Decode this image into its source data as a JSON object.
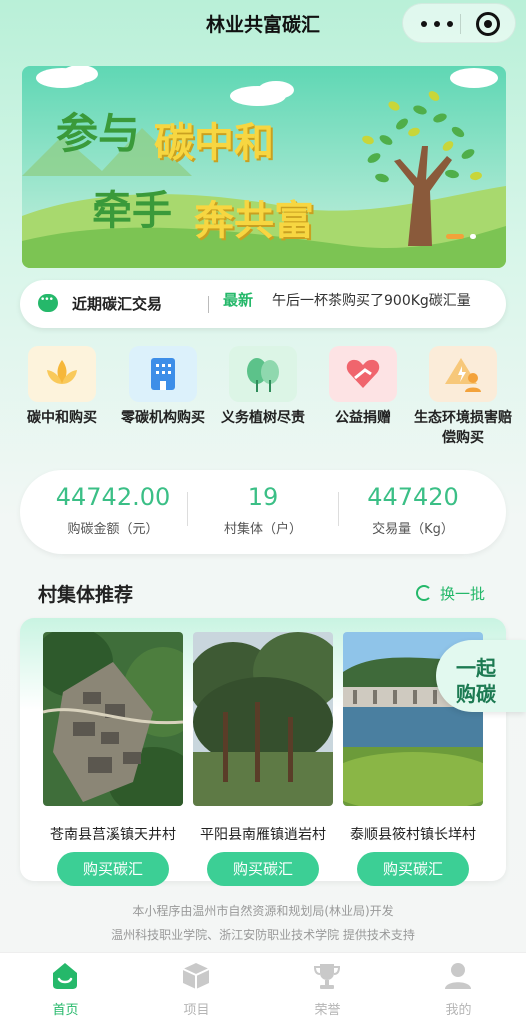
{
  "header": {
    "title": "林业共富碳汇"
  },
  "banner": {
    "line1a": "参与",
    "line1b": "碳中和",
    "line2a": "牵手",
    "line2b": "奔共富"
  },
  "notice": {
    "label": "近期碳汇交易",
    "badge": "最新",
    "text": "午后一杯茶购买了900Kg碳汇量"
  },
  "categories": [
    {
      "label": "碳中和购买",
      "icon": "wheat-icon"
    },
    {
      "label": "零碳机构购买",
      "icon": "building-icon"
    },
    {
      "label": "义务植树尽责",
      "icon": "trees-icon"
    },
    {
      "label": "公益捐赠",
      "icon": "heart-hand-icon"
    },
    {
      "label": "生态环境损害赔偿购买",
      "icon": "warning-person-icon"
    }
  ],
  "stats": [
    {
      "value": "44742.00",
      "label": "购碳金额（元）"
    },
    {
      "value": "19",
      "label": "村集体（户）"
    },
    {
      "value": "447420",
      "label": "交易量（Kg）"
    }
  ],
  "recommend": {
    "title": "村集体推荐",
    "refresh": "换一批",
    "together_line1": "一起",
    "together_line2": "购碳",
    "cards": [
      {
        "name": "苍南县莒溪镇天井村",
        "button": "购买碳汇"
      },
      {
        "name": "平阳县南雁镇逍岩村",
        "button": "购买碳汇"
      },
      {
        "name": "泰顺县筱村镇长垟村",
        "button": "购买碳汇"
      }
    ]
  },
  "footer": {
    "line1": "本小程序由温州市自然资源和规划局(林业局)开发",
    "line2": "温州科技职业学院、浙江安防职业技术学院 提供技术支持"
  },
  "tabs": [
    {
      "label": "首页",
      "active": true
    },
    {
      "label": "项目",
      "active": false
    },
    {
      "label": "荣誉",
      "active": false
    },
    {
      "label": "我的",
      "active": false
    }
  ],
  "colors": {
    "accent": "#25b86a",
    "button": "#3ccf95",
    "stat": "#3bbf86"
  }
}
